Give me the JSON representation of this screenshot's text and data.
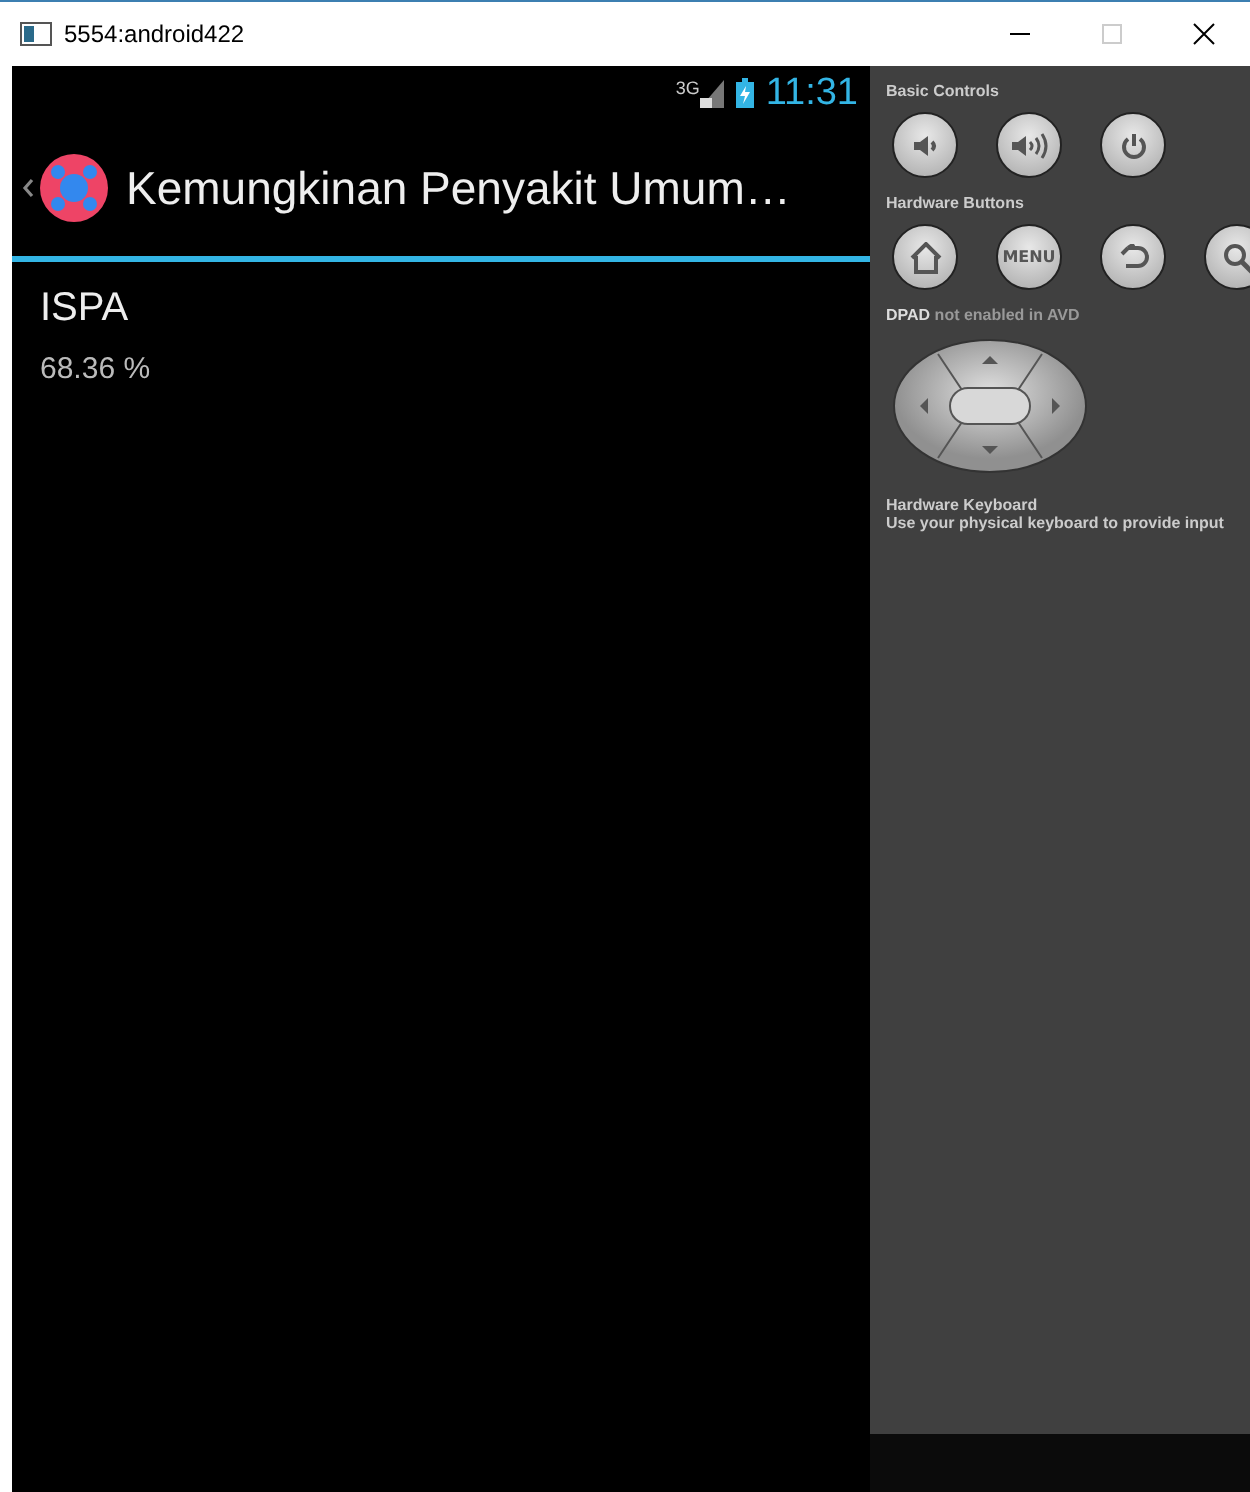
{
  "window": {
    "title": "5554:android422"
  },
  "status_bar": {
    "network": "3G",
    "time": "11:31"
  },
  "action_bar": {
    "title": "Kemungkinan Penyakit Umum…"
  },
  "results": [
    {
      "title": "ISPA",
      "value": "68.36 %"
    }
  ],
  "controls_panel": {
    "sections": [
      {
        "kind": "buttons",
        "label": "Basic Controls",
        "buttons": [
          {
            "kind": "volume-down"
          },
          {
            "kind": "volume-up"
          },
          {
            "kind": "power"
          }
        ]
      },
      {
        "kind": "buttons",
        "label": "Hardware Buttons",
        "buttons": [
          {
            "kind": "home"
          },
          {
            "kind": "menu",
            "label": "MENU"
          },
          {
            "kind": "back"
          },
          {
            "kind": "search"
          }
        ]
      },
      {
        "kind": "dpad",
        "label": "**DPAD** not enabled in AVD"
      },
      {
        "kind": "keyboard",
        "label": "Hardware Keyboard",
        "hint": "Use your physical keyboard to provide input"
      }
    ]
  }
}
